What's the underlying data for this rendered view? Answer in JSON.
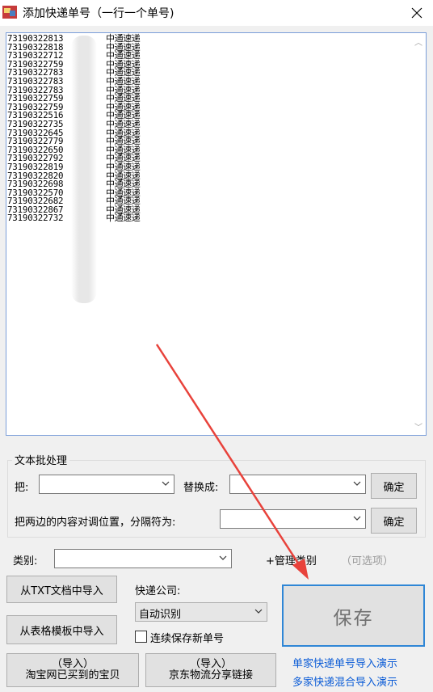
{
  "window": {
    "title": "添加快递单号（一行一个单号)",
    "close_icon": "close-icon",
    "app_icon": "app-icon"
  },
  "tracking_list": {
    "numbers": [
      "73190322813",
      "73190322818",
      "73190322712",
      "73190322759",
      "73190322783",
      "73190322783",
      "73190322783",
      "73190322759",
      "73190322759",
      "73190322516",
      "73190322735",
      "73190322645",
      "73190322779",
      "73190322650",
      "73190322792",
      "73190322819",
      "73190322820",
      "73190322698",
      "73190322570",
      "73190322682",
      "73190322867",
      "73190322732"
    ],
    "carrier": "中通速递"
  },
  "batch": {
    "legend": "文本批处理",
    "replace_label": "把:",
    "replace_with_label": "替换成:",
    "confirm_label": "确定",
    "swap_label": "把两边的内容对调位置，分隔符为:",
    "confirm2_label": "确定"
  },
  "category": {
    "label": "类别:",
    "manage_label": "+管理类别",
    "optional_hint": "（可选项）"
  },
  "import": {
    "txt_label": "从TXT文档中导入",
    "excel_label": "从表格模板中导入",
    "taobao_line1": "（导入）",
    "taobao_line2": "淘宝网已买到的宝贝",
    "jd_line1": "（导入）",
    "jd_line2": "京东物流分享链接"
  },
  "courier": {
    "label": "快递公司:",
    "selected": "自动识别",
    "continuous_label": "连续保存新单号"
  },
  "save_label": "保存",
  "demo_links": {
    "single": "单家快递单号导入演示",
    "mixed": "多家快递混合导入演示"
  },
  "colors": {
    "accent_border": "#2f86d6",
    "link": "#0a5bd6",
    "annotation_arrow": "#e8423b"
  }
}
